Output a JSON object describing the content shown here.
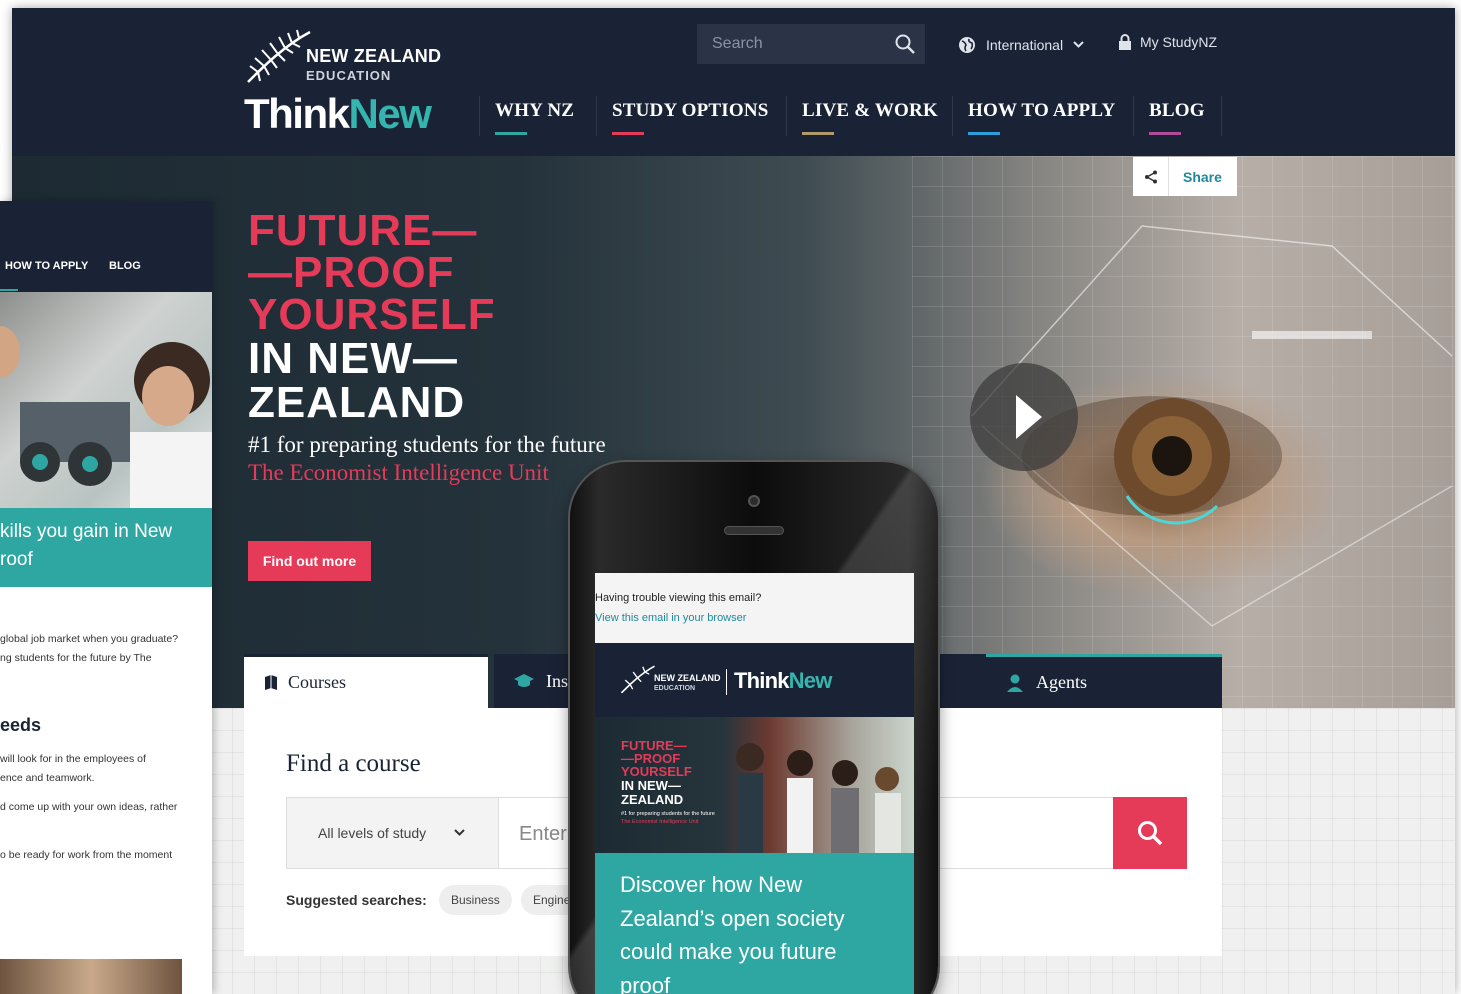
{
  "header": {
    "logo_line1": "NEW ZEALAND",
    "logo_line2": "EDUCATION",
    "logo_think": "Think",
    "logo_new": "New",
    "search_placeholder": "Search",
    "region": "International",
    "account": "My StudyNZ",
    "nav": [
      {
        "label": "WHY NZ",
        "color": "#2ea6a1"
      },
      {
        "label": "STUDY OPTIONS",
        "color": "#e63b58"
      },
      {
        "label": "LIVE & WORK",
        "color": "#b09a6a"
      },
      {
        "label": "HOW TO APPLY",
        "color": "#2e9fd8"
      },
      {
        "label": "BLOG",
        "color": "#b24a9a"
      }
    ]
  },
  "hero": {
    "title_lines": [
      "FUTURE—",
      "—PROOF",
      "YOURSELF",
      "IN NEW—",
      "ZEALAND"
    ],
    "tagline": "#1 for preparing students for the future",
    "source": "The Economist Intelligence Unit",
    "cta": "Find out more",
    "share": "Share"
  },
  "search_panel": {
    "tabs": [
      "Courses",
      "Institutions",
      "Agents"
    ],
    "heading": "Find a course",
    "level_select": "All levels of study",
    "input_placeholder": "Enter",
    "suggested_label": "Suggested searches:",
    "suggestions": [
      "Business",
      "Engine"
    ]
  },
  "left_mock": {
    "nav": [
      "HOW TO APPLY",
      "BLOG"
    ],
    "teal_text": [
      "kills you gain in New",
      "roof"
    ],
    "para1": [
      "global job market when you graduate?",
      "ng students for the future by The"
    ],
    "heading": "eeds",
    "para2": [
      " will look for in the employees of",
      "ence and teamwork.",
      "d come up with your own ideas, rather",
      "o be ready for work from the moment"
    ]
  },
  "phone": {
    "trouble": "Having trouble viewing this email?",
    "view_link": "View this email in your browser",
    "logo_nz": "NEW ZEALAND",
    "logo_ed": "EDUCATION",
    "logo_think": "Think",
    "logo_new": "New",
    "mini_title": [
      "FUTURE—",
      "—PROOF",
      "YOURSELF",
      "IN NEW—",
      "ZEALAND"
    ],
    "mini_tag": "#1 for preparing students for the future",
    "mini_src": "The Economist Intelligence Unit",
    "headline": [
      "Discover how New",
      "Zealand’s open society",
      "could make you future",
      "proof"
    ]
  },
  "colors": {
    "navy": "#1a2336",
    "pink": "#e63b58",
    "teal": "#2ea6a1"
  }
}
